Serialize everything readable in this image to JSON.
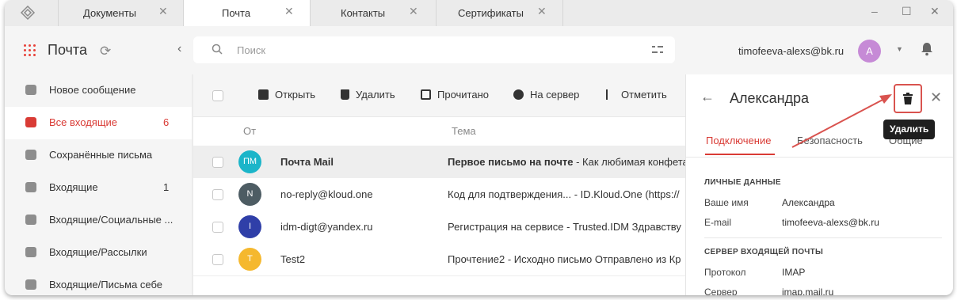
{
  "tabs": [
    {
      "label": "Документы",
      "active": false
    },
    {
      "label": "Почта",
      "active": true
    },
    {
      "label": "Контакты",
      "active": false
    },
    {
      "label": "Сертификаты",
      "active": false
    }
  ],
  "window_controls": {
    "minimize": "–",
    "maximize": "☐",
    "close": "✕"
  },
  "header": {
    "app_title": "Почта",
    "search_placeholder": "Поиск",
    "user_email": "timofeeva-alexs@bk.ru",
    "user_avatar_letter": "A"
  },
  "sidebar": {
    "items": [
      {
        "label": "Новое сообщение",
        "count": "",
        "icon": "plus-icon",
        "active": false
      },
      {
        "label": "Все входящие",
        "count": "6",
        "icon": "inbox-icon",
        "active": true
      },
      {
        "label": "Сохранённые письма",
        "count": "",
        "icon": "save-icon",
        "active": false
      },
      {
        "label": "Входящие",
        "count": "1",
        "icon": "mail-icon",
        "active": false
      },
      {
        "label": "Входящие/Социальные ...",
        "count": "",
        "icon": "folder-icon",
        "active": false
      },
      {
        "label": "Входящие/Рассылки",
        "count": "",
        "icon": "folder-icon",
        "active": false
      },
      {
        "label": "Входящие/Письма себе",
        "count": "",
        "icon": "folder-icon",
        "active": false
      }
    ]
  },
  "toolbar": {
    "open": "Открыть",
    "delete": "Удалить",
    "read": "Прочитано",
    "to_server": "На сервер",
    "mark": "Отметить"
  },
  "list": {
    "col_from": "От",
    "col_subject": "Тема",
    "rows": [
      {
        "initials": "ПМ",
        "avatar_color": "#1bb5c9",
        "from": "Почта Mail",
        "subject_bold": "Первое письмо на почте",
        "subject_rest": " - Как любимая конфета",
        "selected": true
      },
      {
        "initials": "N",
        "avatar_color": "#4d5c63",
        "from": "no-reply@kloud.one",
        "subject_bold": "",
        "subject_rest": "Код для подтверждения...  -  ID.Kloud.One (https://",
        "selected": false
      },
      {
        "initials": "I",
        "avatar_color": "#2f3fa8",
        "from": "idm-digt@yandex.ru",
        "subject_bold": "",
        "subject_rest": "Регистрация на сервисе  -  Trusted.IDM Здравству",
        "selected": false
      },
      {
        "initials": "T",
        "avatar_color": "#f5b82e",
        "from": "Test2",
        "subject_bold": "",
        "subject_rest": "Прочтение2  -  Исходно письмо Отправлено из Кр",
        "selected": false
      }
    ]
  },
  "panel": {
    "title": "Александра",
    "tooltip": "Удалить",
    "tabs": [
      "Подключение",
      "Безопасность",
      "Общие"
    ],
    "personal_section": "ЛИЧНЫЕ ДАННЫЕ",
    "name_label": "Ваше имя",
    "name_value": "Александра",
    "email_label": "E-mail",
    "email_value": "timofeeva-alexs@bk.ru",
    "server_section": "СЕРВЕР ВХОДЯЩЕЙ ПОЧТЫ",
    "protocol_label": "Протокол",
    "protocol_value": "IMAP",
    "server_label": "Сервер",
    "server_value": "imap.mail.ru"
  },
  "colors": {
    "accent": "#d93b35",
    "annotation": "#d9534f"
  }
}
